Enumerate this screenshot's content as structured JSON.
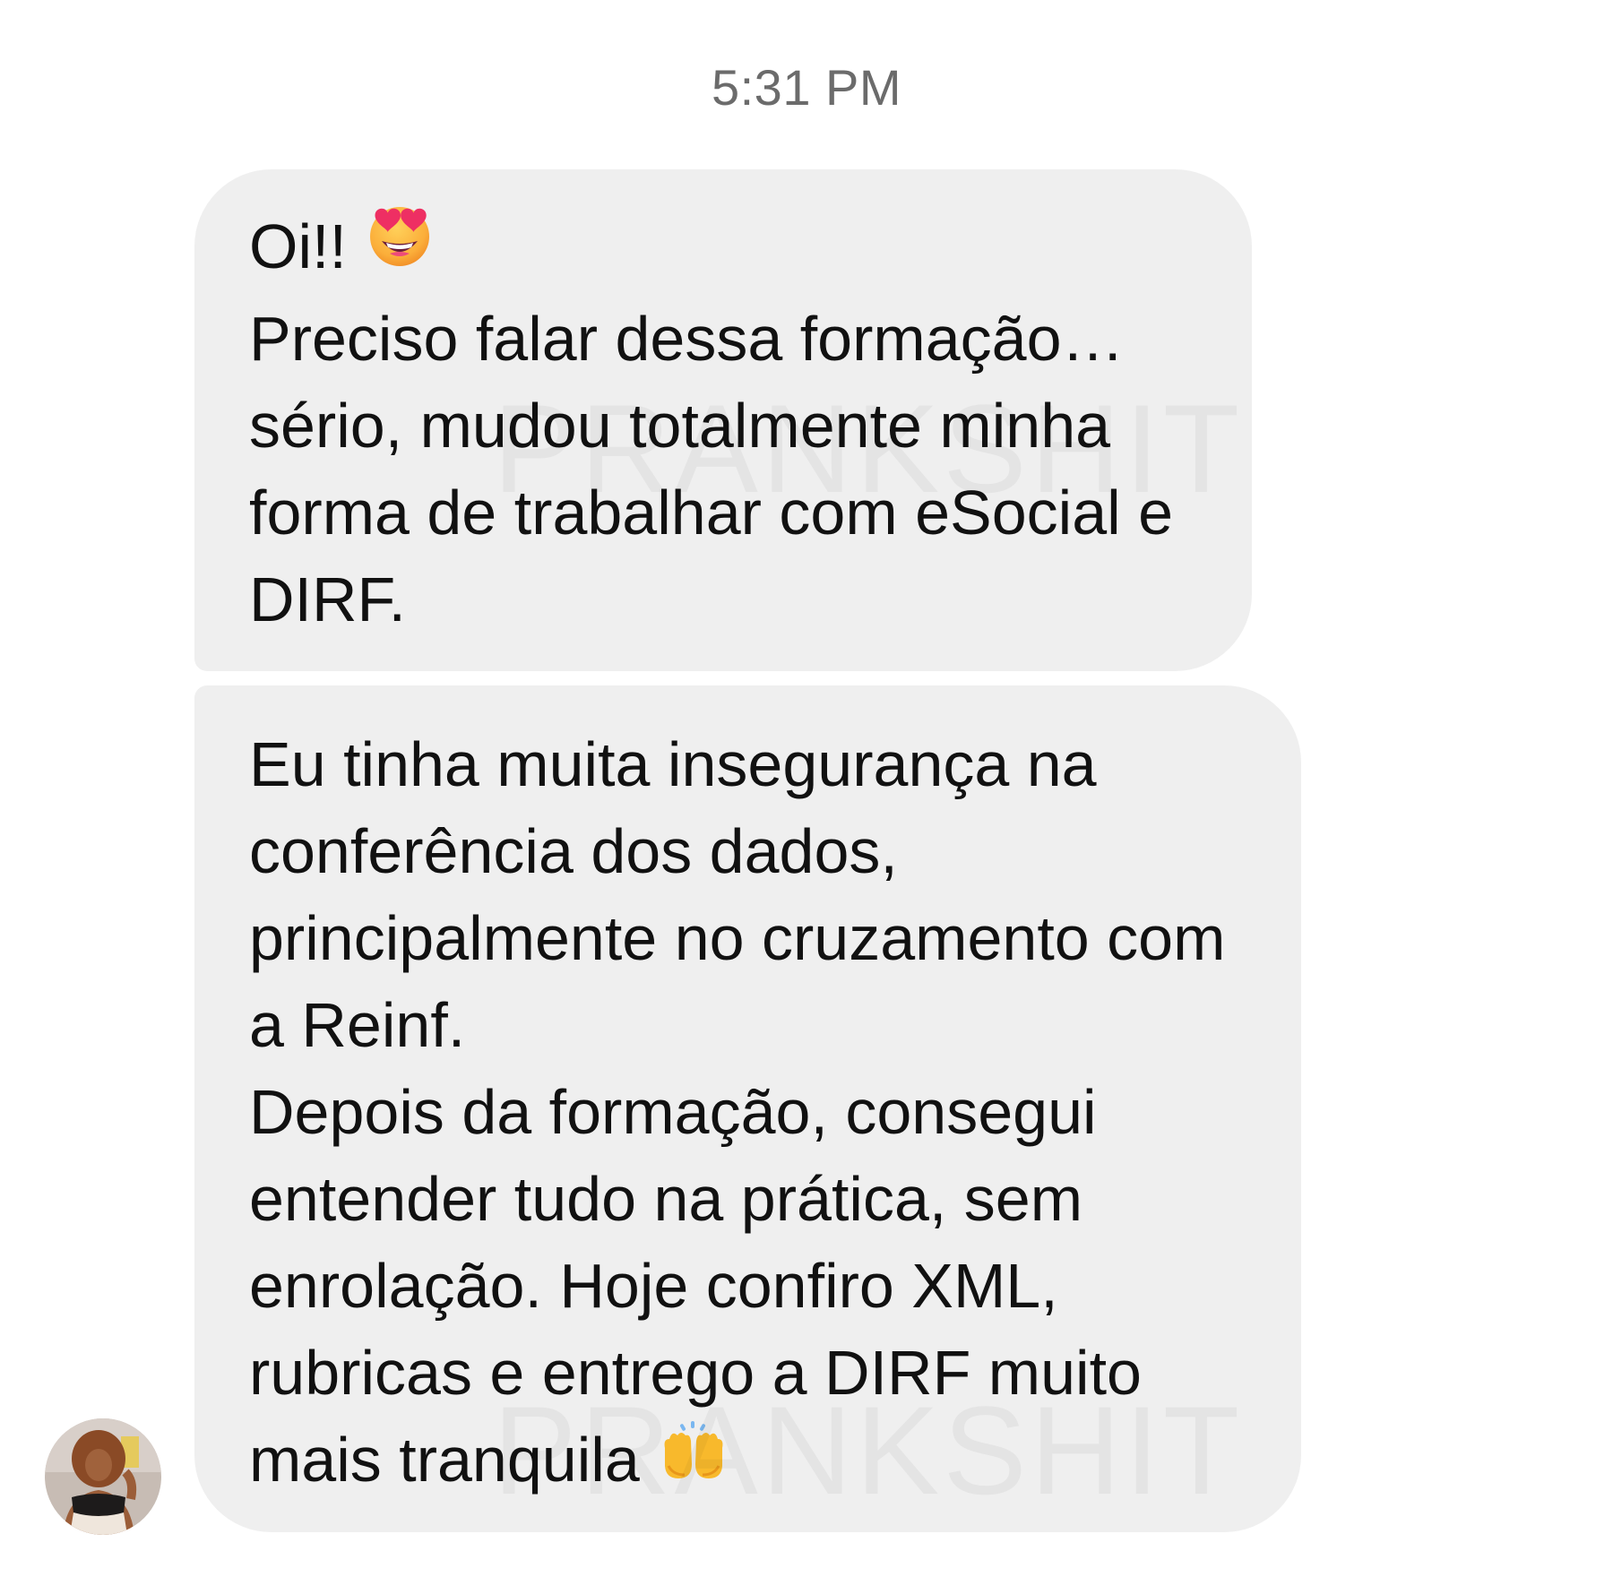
{
  "chat": {
    "timestamp": "5:31 PM",
    "messages": [
      {
        "lines": [
          "Oi!!",
          "Preciso falar dessa formação…",
          "sério, mudou totalmente minha",
          "forma de trabalhar com eSocial e",
          "DIRF."
        ],
        "emoji": "star-struck-emoji"
      },
      {
        "lines": [
          "Eu tinha muita insegurança na",
          "conferência dos dados,",
          "principalmente no cruzamento com",
          "a Reinf.",
          "Depois da formação, consegui",
          "entender tudo na prática, sem",
          "enrolação. Hoje confiro XML,",
          "rubricas e entrego a DIRF muito",
          "mais tranquila"
        ],
        "emoji": "raising-hands-emoji"
      }
    ],
    "watermark": "PRANKSHIT",
    "avatar": "contact-avatar"
  },
  "colors": {
    "bubble": "#efefef",
    "text": "#111111",
    "timestamp": "#6b6b6b",
    "background": "#ffffff"
  }
}
